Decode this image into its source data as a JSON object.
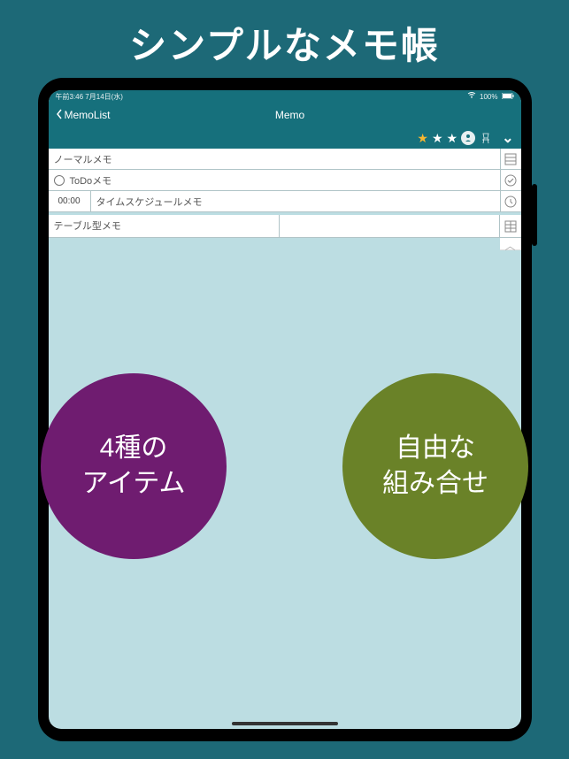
{
  "promo": {
    "title": "シンプルなメモ帳"
  },
  "status": {
    "left": "午前3:46  7月14日(水)",
    "wifi": "wifi-icon",
    "battery_pct": "100%"
  },
  "nav": {
    "back_label": "MemoList",
    "title": "Memo"
  },
  "toolbar": {
    "stars": [
      true,
      false,
      false
    ],
    "person_icon": "person-icon",
    "chair_icon": "chair-icon"
  },
  "memo_rows": [
    {
      "type": "normal",
      "text": "ノーマルメモ",
      "icon": "lines-icon"
    },
    {
      "type": "todo",
      "text": "ToDoメモ",
      "icon": "check-circle-icon"
    },
    {
      "type": "time",
      "time": "00:00",
      "text": "タイムスケジュールメモ",
      "icon": "clock-icon"
    },
    {
      "type": "table",
      "text": "テーブル型メモ",
      "icon": "grid-icon"
    }
  ],
  "bubbles": {
    "left_line1": "4種の",
    "left_line2": "アイテム",
    "right_line1": "自由な",
    "right_line2": "組み合せ"
  }
}
